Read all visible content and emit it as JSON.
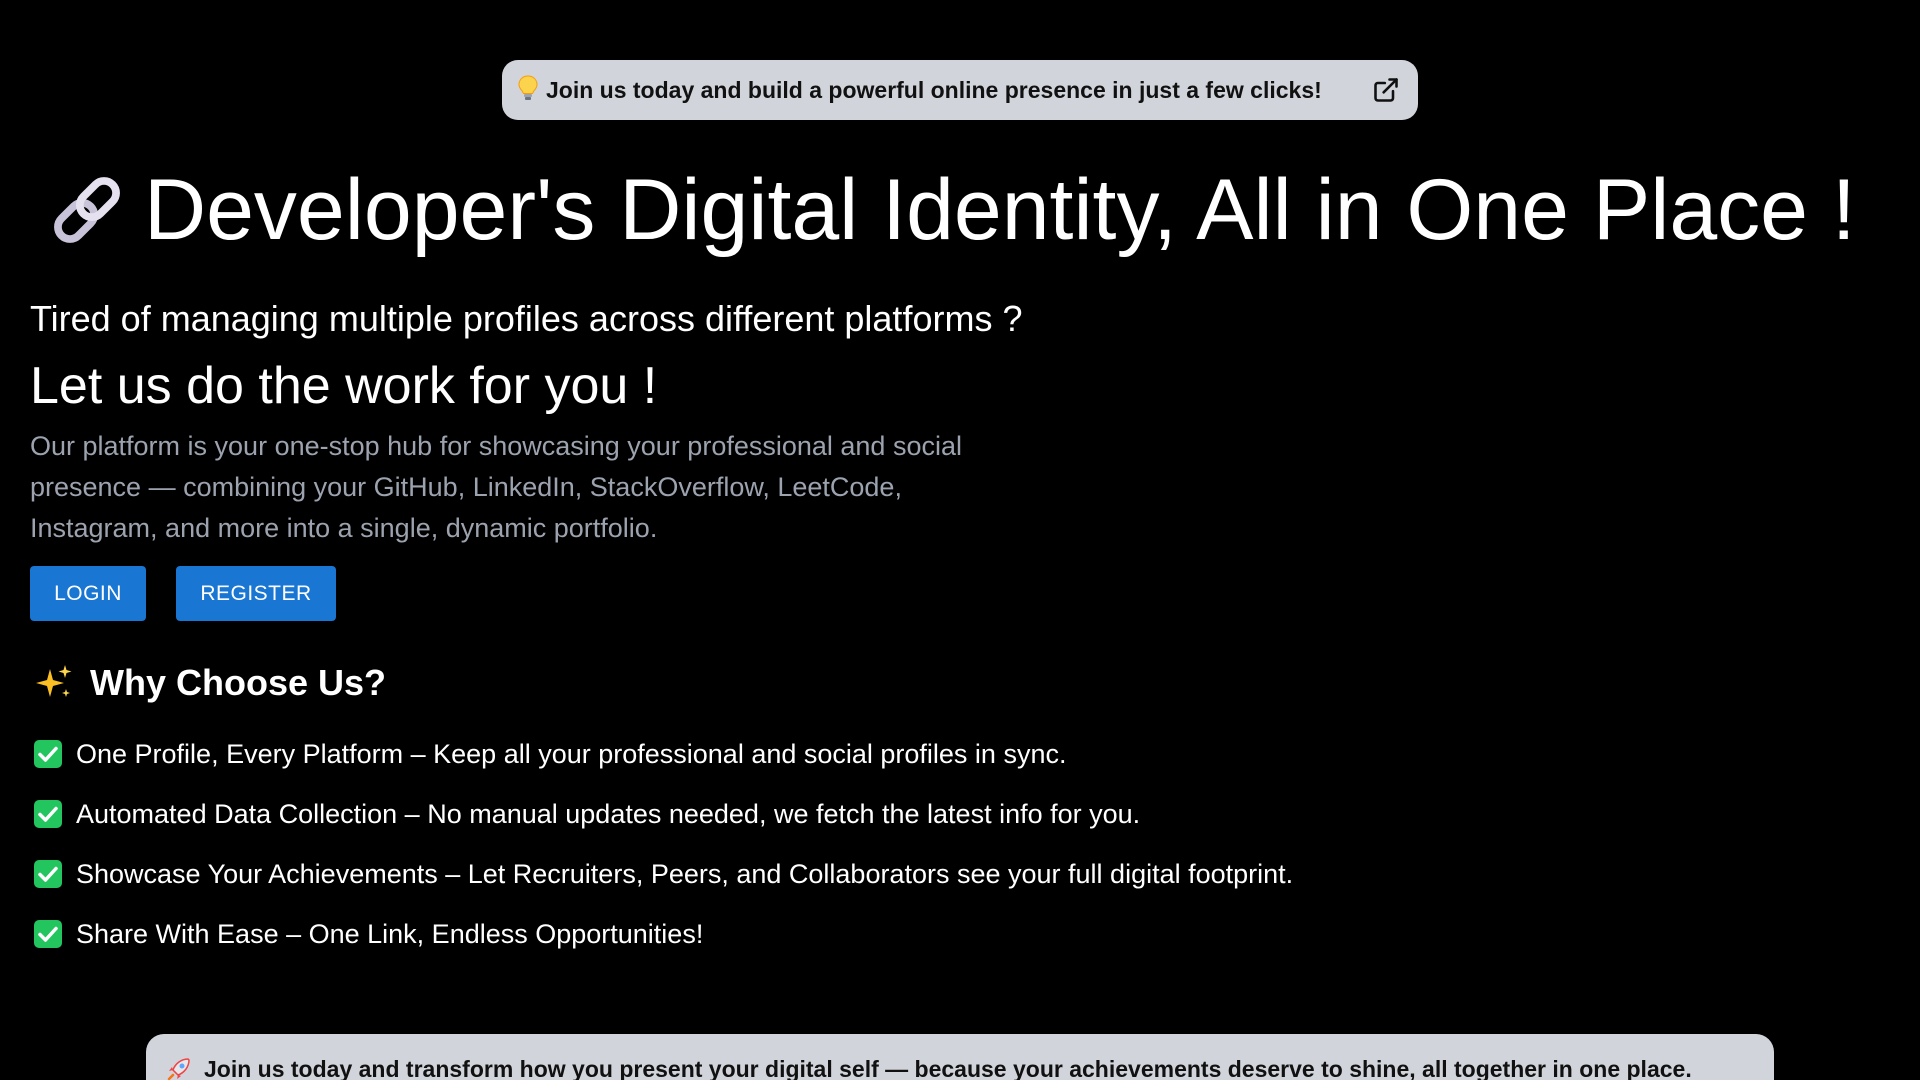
{
  "top_banner": {
    "icon": "lightbulb-icon",
    "text": "Join us today and build a powerful online presence in just a few clicks!",
    "action_icon": "external-link-icon"
  },
  "hero": {
    "icon": "link-icon",
    "title": "Developer's Digital Identity, All in One Place !",
    "subtitle": "Tired of managing multiple profiles across different platforms ?",
    "tagline": "Let us do the work for you !",
    "description": "Our platform is your one-stop hub for showcasing your professional and social presence — combining your GitHub, LinkedIn, StackOverflow, LeetCode, Instagram, and more into a single, dynamic portfolio."
  },
  "buttons": {
    "login_label": "LOGIN",
    "register_label": "REGISTER",
    "color": "#1976d2"
  },
  "why": {
    "icon": "sparkles-icon",
    "heading": "Why Choose Us?",
    "items": [
      {
        "icon": "check-icon",
        "text": "One Profile, Every Platform – Keep all your professional and social profiles in sync."
      },
      {
        "icon": "check-icon",
        "text": "Automated Data Collection – No manual updates needed, we fetch the latest info for you."
      },
      {
        "icon": "check-icon",
        "text": "Showcase Your Achievements – Let Recruiters, Peers, and Collaborators see your full digital footprint."
      },
      {
        "icon": "check-icon",
        "text": "Share With Ease – One Link, Endless Opportunities!"
      }
    ]
  },
  "bottom_banner": {
    "icon": "rocket-icon",
    "text": "Join us today and transform how you present your digital self — because your achievements deserve to shine, all together in one place."
  },
  "colors": {
    "background": "#000000",
    "banner_bg": "#d1d5db",
    "muted_text": "#9ca3af",
    "check_green": "#22c55e"
  }
}
